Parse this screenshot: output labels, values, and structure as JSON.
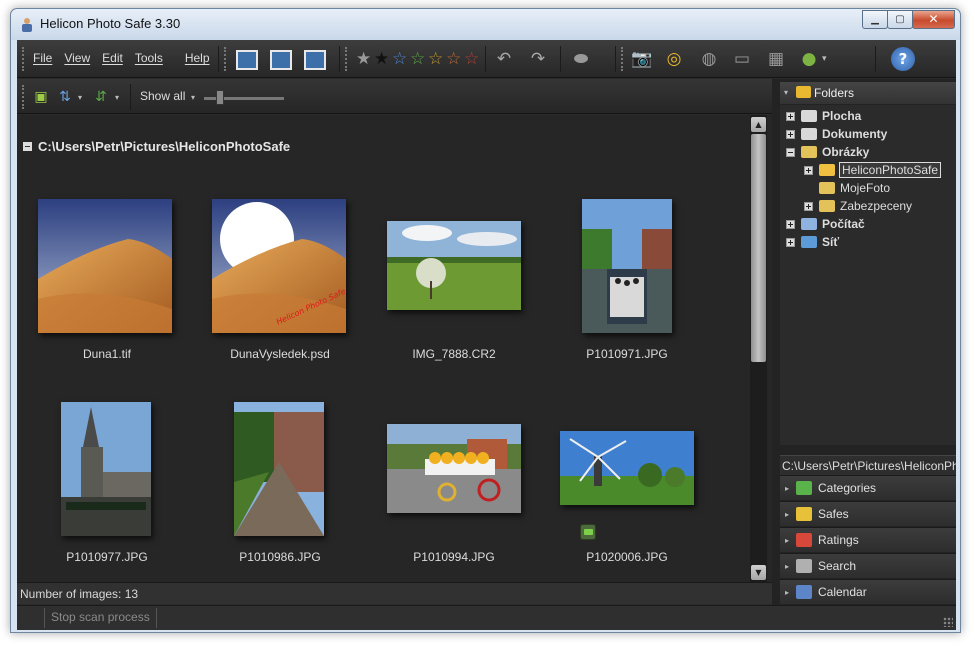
{
  "window": {
    "title": "Helicon Photo Safe 3.30"
  },
  "menu": [
    "File",
    "View",
    "Edit",
    "Tools",
    "Help"
  ],
  "toolbar2": {
    "filter_label": "Show all"
  },
  "browser": {
    "folder_path": "C:\\Users\\Petr\\Pictures\\HeliconPhotoSafe",
    "images": [
      {
        "name": "Duna1.tif"
      },
      {
        "name": "DunaVysledek.psd",
        "overlay_text": "Helicon Photo Safe"
      },
      {
        "name": "IMG_7888.CR2"
      },
      {
        "name": "P1010971.JPG"
      },
      {
        "name": "P1010977.JPG"
      },
      {
        "name": "P1010986.JPG"
      },
      {
        "name": "P1010994.JPG"
      },
      {
        "name": "P1020006.JPG",
        "has_category_tag": true
      }
    ],
    "image_count_text": "Number of images: 13"
  },
  "status": {
    "stop_button": "Stop scan process"
  },
  "folders_panel": {
    "title": "Folders",
    "tree": [
      {
        "label": "Plocha",
        "bold": true,
        "indent": 0,
        "expander": "plus"
      },
      {
        "label": "Dokumenty",
        "bold": true,
        "indent": 0,
        "expander": "plus"
      },
      {
        "label": "Obrázky",
        "bold": true,
        "indent": 0,
        "expander": "minus"
      },
      {
        "label": "HeliconPhotoSafe",
        "bold": false,
        "indent": 1,
        "expander": "plus",
        "selected": true
      },
      {
        "label": "MojeFoto",
        "bold": false,
        "indent": 1,
        "expander": "none"
      },
      {
        "label": "Zabezpeceny",
        "bold": false,
        "indent": 1,
        "expander": "plus"
      },
      {
        "label": "Počítač",
        "bold": true,
        "indent": 0,
        "expander": "plus"
      },
      {
        "label": "Síť",
        "bold": true,
        "indent": 0,
        "expander": "plus"
      }
    ],
    "current_path": "C:\\Users\\Petr\\Pictures\\HeliconPhotoSafe"
  },
  "accordion": [
    {
      "label": "Categories",
      "icon": "tag-icon",
      "color": "#5ab34a"
    },
    {
      "label": "Safes",
      "icon": "lock-icon",
      "color": "#e8c13a"
    },
    {
      "label": "Ratings",
      "icon": "rating-icon",
      "color": "#d8483a"
    },
    {
      "label": "Search",
      "icon": "search-icon",
      "color": "#b0b0b0"
    },
    {
      "label": "Calendar",
      "icon": "calendar-icon",
      "color": "#5d86c8"
    }
  ],
  "colors": {
    "background": "#262626",
    "text": "#dcdcdc",
    "window_frame": "#d7e3f1"
  }
}
